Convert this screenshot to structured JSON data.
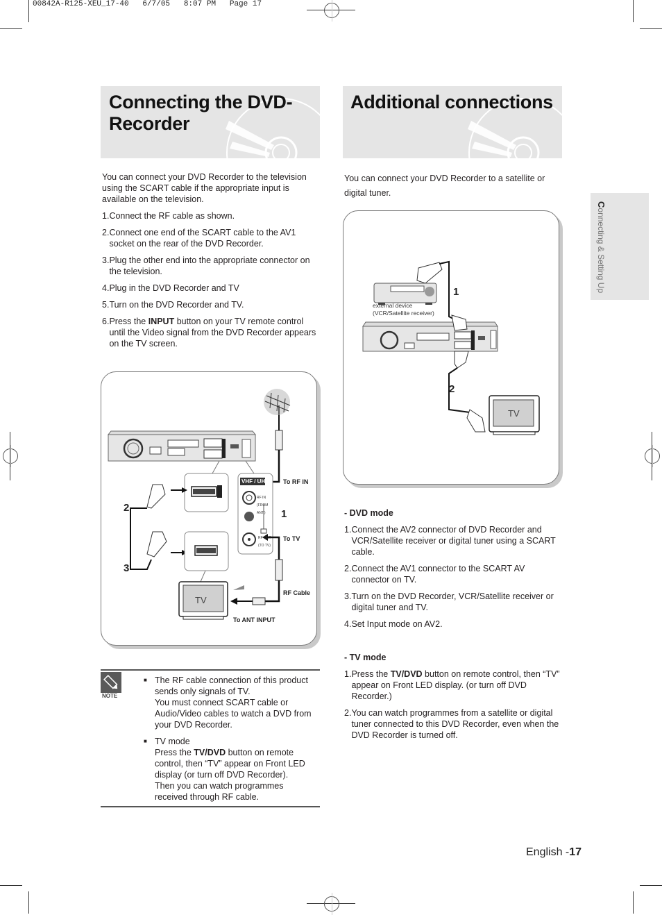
{
  "slug": "00842A-R125-XEU_17-40   6/7/05   8:07 PM   Page 17",
  "left": {
    "title": "Connecting the DVD-Recorder",
    "title_line1": "Connecting the DVD-",
    "title_line2": "Recorder",
    "intro": "You can connect your DVD Recorder to the television using the SCART cable if the appropriate input is available on the television.",
    "steps": [
      {
        "num": "1. ",
        "text": "Connect the RF cable as shown."
      },
      {
        "num": "2. ",
        "text": "Connect one end of the SCART cable to the AV1 socket on the rear of the DVD Recorder."
      },
      {
        "num": "3. ",
        "text": "Plug the other end into the appropriate connector on the television."
      },
      {
        "num": "4. ",
        "text": "Plug in the DVD Recorder and TV"
      },
      {
        "num": "5.",
        "text": "Turn on the DVD Recorder and TV."
      },
      {
        "num": "6. ",
        "text_before": "Press the ",
        "bold": "INPUT",
        "text_after": " button on your TV remote control until the Video signal from the DVD Recorder appears on the TV screen."
      }
    ],
    "diagram": {
      "labels": {
        "to_rf_in": "To RF IN",
        "to_tv": "To TV",
        "rf_cable": "RF Cable",
        "to_ant_input": "To ANT INPUT",
        "vhf_uhf": "VHF / UHF",
        "rf_in_small": "RF IN (FROM ANT.)",
        "rf_out_small": "RF OUT (TO TV)",
        "tv": "TV",
        "step1": "1",
        "step2": "2",
        "step3": "3"
      }
    },
    "note": {
      "label": "NOTE",
      "bullets": [
        {
          "lines": [
            "The RF cable connection of this product sends only signals of TV.",
            "You must connect SCART cable or Audio/Video cables to watch a DVD from your DVD Recorder."
          ]
        },
        {
          "title": "TV mode",
          "text_before": "Press the ",
          "bold": "TV/DVD",
          "text_after": " button on remote control, then “TV” appear on Front LED display (or turn off DVD Recorder).",
          "extra": "Then you can watch programmes received through RF cable."
        }
      ]
    }
  },
  "right": {
    "title": "Additional connections",
    "intro": "You can connect your DVD Recorder to a satellite or digital tuner.",
    "diagram": {
      "external_device_line1": "external device",
      "external_device_line2": "(VCR/Satellite receiver)",
      "tv": "TV",
      "step1": "1",
      "step2": "2"
    },
    "dvd_mode": {
      "heading": "- DVD mode",
      "steps": [
        {
          "num": "1. ",
          "text": "Connect the AV2 connector of DVD Recorder and VCR/Satellite receiver or digital tuner using a SCART cable."
        },
        {
          "num": "2. ",
          "text": "Connect the AV1 connector to the SCART AV connector on TV."
        },
        {
          "num": "3. ",
          "text": "Turn on the DVD Recorder, VCR/Satellite receiver or digital tuner and TV."
        },
        {
          "num": "4. ",
          "text": "Set Input mode on AV2."
        }
      ]
    },
    "tv_mode": {
      "heading": "- TV mode",
      "steps": [
        {
          "num": "1. ",
          "text_before": "Press the ",
          "bold": "TV/DVD",
          "text_after": " button on remote control, then “TV” appear on Front LED display. (or turn off DVD Recorder.)"
        },
        {
          "num": "2. ",
          "text": "You can watch programmes from a satellite or digital tuner connected to this DVD Recorder, even when the DVD Recorder is turned off."
        }
      ]
    }
  },
  "side_tab": {
    "first_letter": "C",
    "rest": "onnecting & Setting Up"
  },
  "footer": {
    "language": "English -",
    "page": "17"
  }
}
